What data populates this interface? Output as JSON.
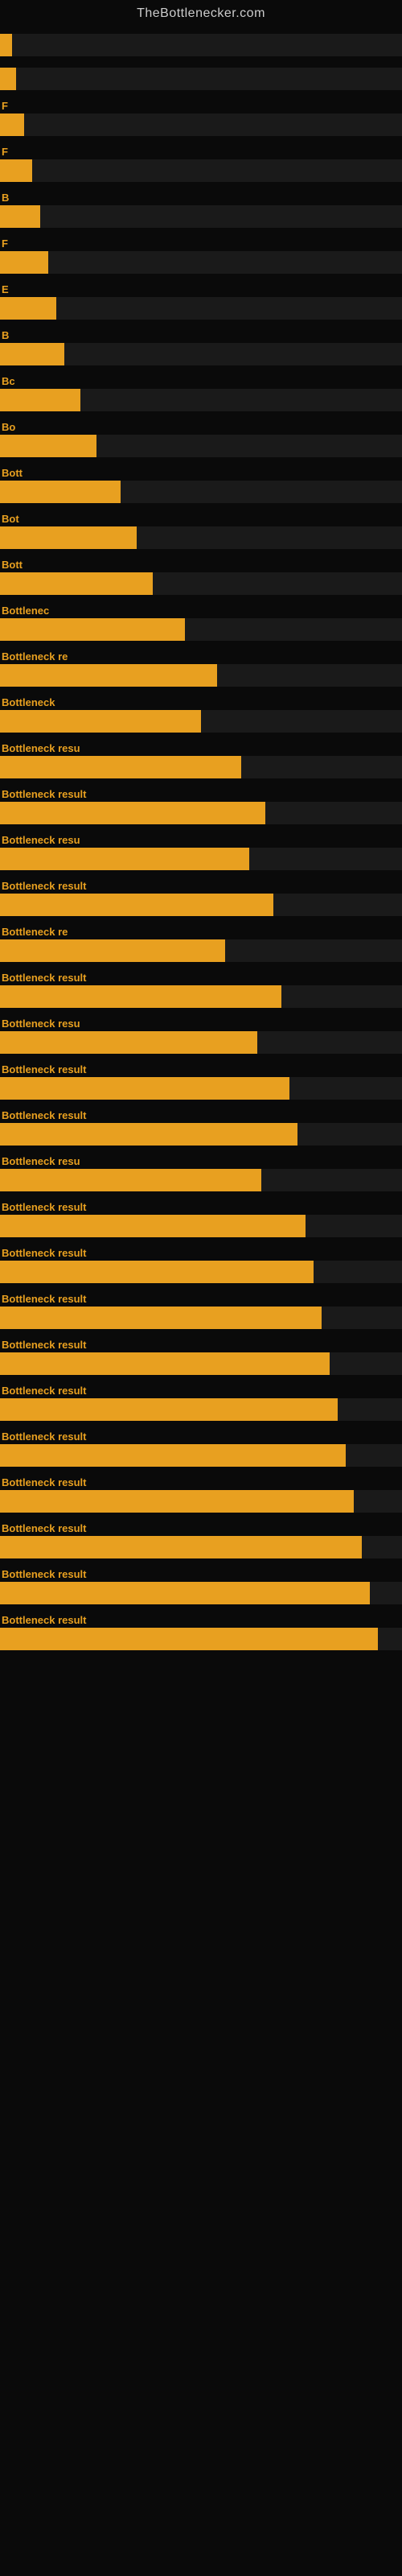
{
  "site": {
    "title": "TheBottlenecker.com"
  },
  "bars": [
    {
      "label": "",
      "width": 3
    },
    {
      "label": "",
      "width": 4
    },
    {
      "label": "F",
      "width": 6
    },
    {
      "label": "F",
      "width": 8
    },
    {
      "label": "B",
      "width": 10
    },
    {
      "label": "F",
      "width": 12
    },
    {
      "label": "E",
      "width": 14
    },
    {
      "label": "B",
      "width": 16
    },
    {
      "label": "Bc",
      "width": 20
    },
    {
      "label": "Bo",
      "width": 24
    },
    {
      "label": "Bott",
      "width": 30
    },
    {
      "label": "Bot",
      "width": 34
    },
    {
      "label": "Bott",
      "width": 38
    },
    {
      "label": "Bottlenec",
      "width": 46
    },
    {
      "label": "Bottleneck re",
      "width": 54
    },
    {
      "label": "Bottleneck",
      "width": 50
    },
    {
      "label": "Bottleneck resu",
      "width": 60
    },
    {
      "label": "Bottleneck result",
      "width": 66
    },
    {
      "label": "Bottleneck resu",
      "width": 62
    },
    {
      "label": "Bottleneck result",
      "width": 68
    },
    {
      "label": "Bottleneck re",
      "width": 56
    },
    {
      "label": "Bottleneck result",
      "width": 70
    },
    {
      "label": "Bottleneck resu",
      "width": 64
    },
    {
      "label": "Bottleneck result",
      "width": 72
    },
    {
      "label": "Bottleneck result",
      "width": 74
    },
    {
      "label": "Bottleneck resu",
      "width": 65
    },
    {
      "label": "Bottleneck result",
      "width": 76
    },
    {
      "label": "Bottleneck result",
      "width": 78
    },
    {
      "label": "Bottleneck result",
      "width": 80
    },
    {
      "label": "Bottleneck result",
      "width": 82
    },
    {
      "label": "Bottleneck result",
      "width": 84
    },
    {
      "label": "Bottleneck result",
      "width": 86
    },
    {
      "label": "Bottleneck result",
      "width": 88
    },
    {
      "label": "Bottleneck result",
      "width": 90
    },
    {
      "label": "Bottleneck result",
      "width": 92
    },
    {
      "label": "Bottleneck result",
      "width": 94
    }
  ]
}
